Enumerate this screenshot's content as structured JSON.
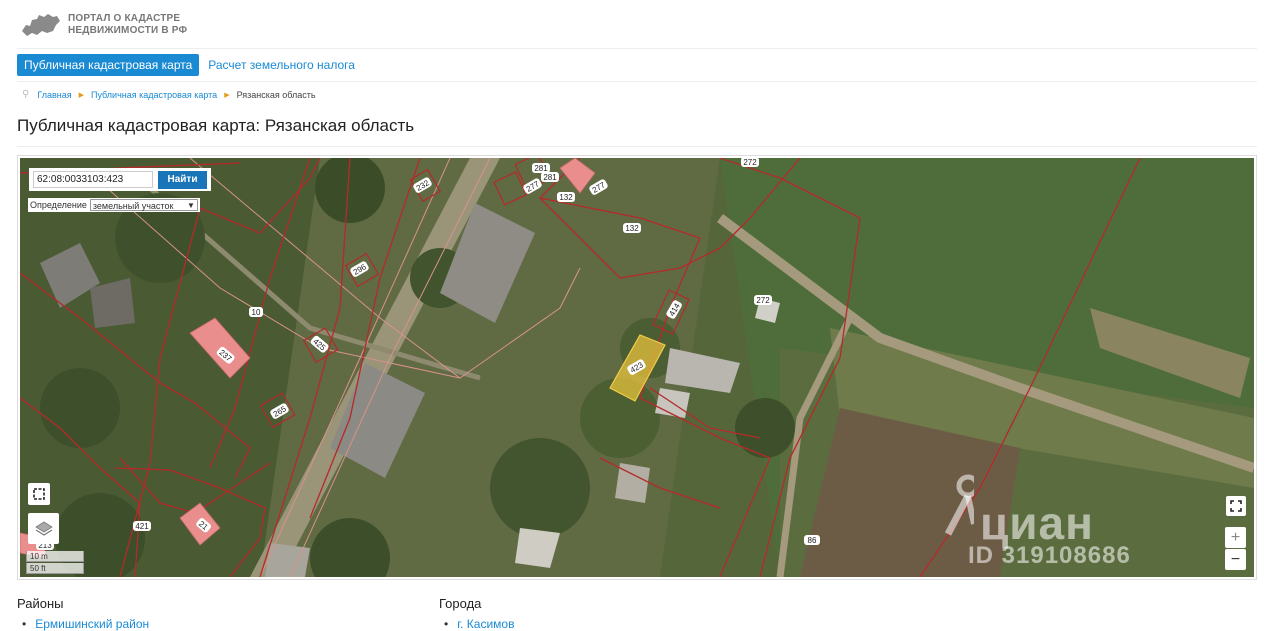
{
  "header": {
    "logo_line1": "ПОРТАЛ О КАДАСТРЕ",
    "logo_line2": "НЕДВИЖИМОСТИ В РФ"
  },
  "tabs": {
    "active": "Публичная кадастровая карта",
    "other": "Расчет земельного налога"
  },
  "breadcrumb": {
    "home": "Главная",
    "map": "Публичная кадастровая карта",
    "current": "Рязанская область"
  },
  "page_title": "Публичная кадастровая карта: Рязанская область",
  "map": {
    "search": {
      "value": "62:08:0033103:423",
      "button": "Найти"
    },
    "definition": {
      "label": "Определение",
      "selected": "земельный участок"
    },
    "scale": {
      "metric": "10 m",
      "imperial": "50 ft"
    },
    "zoom": {
      "plus": "+",
      "minus": "−"
    },
    "parcel_labels": {
      "p281": "281",
      "p281b": "281",
      "p277": "277",
      "p277b": "277",
      "p232": "232",
      "p132": "132",
      "p132b": "132",
      "p272": "272",
      "p272b": "272",
      "p296": "296",
      "p10": "10",
      "p237": "237",
      "p425": "425",
      "p414": "414",
      "p423": "423",
      "p265": "265",
      "p421": "421",
      "p21": "21",
      "p213": "213",
      "p86": "86"
    },
    "watermark": {
      "brand": "циан",
      "id": "ID 319108686"
    },
    "colors": {
      "boundary": "#b52a2a",
      "selected_fill": "#e6c13c",
      "building_fill": "#ea8d8d"
    }
  },
  "sections": {
    "districts": {
      "title": "Районы",
      "first_item": "Ермишинский район"
    },
    "cities": {
      "title": "Города",
      "first_item": "г. Касимов"
    }
  }
}
